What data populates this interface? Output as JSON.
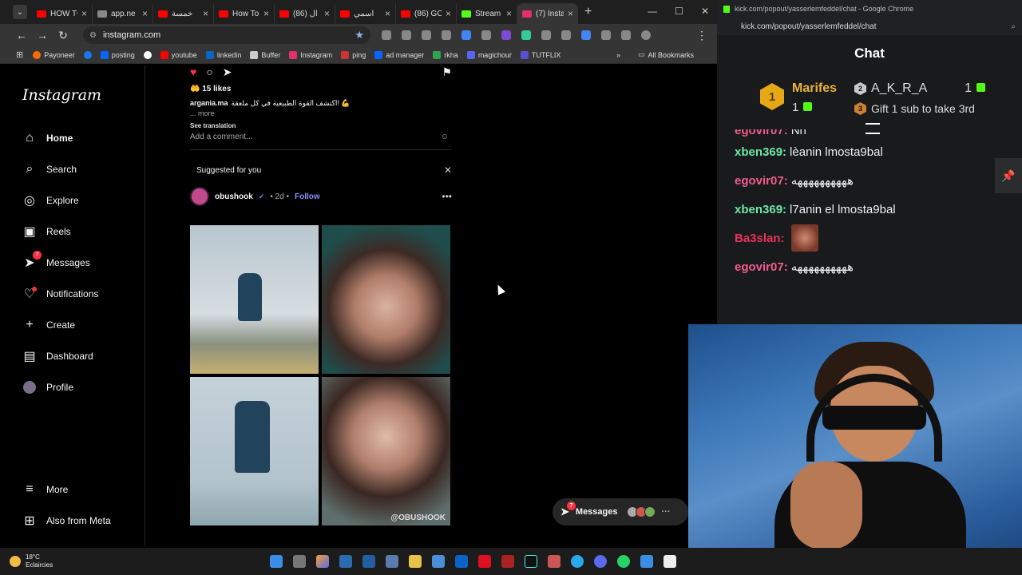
{
  "browser": {
    "tabs": [
      {
        "label": "HOW TO",
        "color": "#ff0000"
      },
      {
        "label": "app.ne",
        "color": "#888888"
      },
      {
        "label": "خمسة",
        "color": "#ff0000"
      },
      {
        "label": "How To",
        "color": "#ff0000"
      },
      {
        "label": "(86) ال",
        "color": "#ff0000"
      },
      {
        "label": "اسمي",
        "color": "#ff0000"
      },
      {
        "label": "(86) GC",
        "color": "#ff0000"
      },
      {
        "label": "Stream",
        "color": "#53fc18"
      },
      {
        "label": "(7) Insta",
        "color": "#e1306c"
      }
    ],
    "url": "instagram.com",
    "bookmarks": [
      "Payoneer",
      "posting",
      "youtube",
      "linkedin",
      "Buffer",
      "Instagram",
      "ping",
      "ad manager",
      "rkha",
      "magichour",
      "TUTFLIX"
    ],
    "all_bookmarks": "All Bookmarks"
  },
  "instagram": {
    "logo": "Instagram",
    "nav": [
      {
        "label": "Home",
        "icon": "home-icon"
      },
      {
        "label": "Search",
        "icon": "search-icon"
      },
      {
        "label": "Explore",
        "icon": "explore-icon"
      },
      {
        "label": "Reels",
        "icon": "reels-icon"
      },
      {
        "label": "Messages",
        "icon": "messages-icon",
        "badge": "7"
      },
      {
        "label": "Notifications",
        "icon": "heart-icon"
      },
      {
        "label": "Create",
        "icon": "plus-icon"
      },
      {
        "label": "Dashboard",
        "icon": "dashboard-icon"
      },
      {
        "label": "Profile",
        "icon": "avatar"
      }
    ],
    "more": "More",
    "also_meta": "Also from Meta",
    "post": {
      "likes": "15 likes",
      "username": "argania.ma",
      "caption": "اكتشف القوة الطبيعية في كل ملعقة! 💪",
      "more": "... more",
      "see_translation": "See translation",
      "add_comment": "Add a comment..."
    },
    "suggested": "Suggested for you",
    "suggested_post": {
      "username": "obushook",
      "age": "2d",
      "follow": "Follow",
      "watermark": "@OBUSHOOK"
    },
    "messages_pill": {
      "label": "Messages",
      "badge": "7"
    }
  },
  "taskbar": {
    "temp": "18°C",
    "condition": "Eclaircies"
  },
  "chat": {
    "window_title": "kick.com/popout/yasserlemfeddel/chat - Google Chrome",
    "url": "kick.com/popout/yasserlemfeddel/chat",
    "title": "Chat",
    "leaderboard": {
      "first": {
        "rank": "1",
        "name": "Marifes",
        "count": "1"
      },
      "second": {
        "rank": "2",
        "name": "A_K_R_A",
        "count": "1"
      },
      "third": {
        "rank": "3",
        "text": "Gift 1 sub to take 3rd"
      }
    },
    "messages": [
      {
        "user": "egovir07:",
        "text": "Nh",
        "color": "#f25d8e"
      },
      {
        "user": "xben369:",
        "text": "lèanin lmosta9bal",
        "color": "#6ee7a8"
      },
      {
        "user": "egovir07:",
        "text": "ههههههههههه",
        "color": "#f25d8e"
      },
      {
        "user": "xben369:",
        "text": "l7anin el lmosta9bal",
        "color": "#6ee7a8"
      },
      {
        "user": "Ba3slan:",
        "text": "",
        "color": "#e8345a",
        "emote": true
      },
      {
        "user": "egovir07:",
        "text": "ههههههههههه",
        "color": "#f25d8e"
      }
    ]
  }
}
